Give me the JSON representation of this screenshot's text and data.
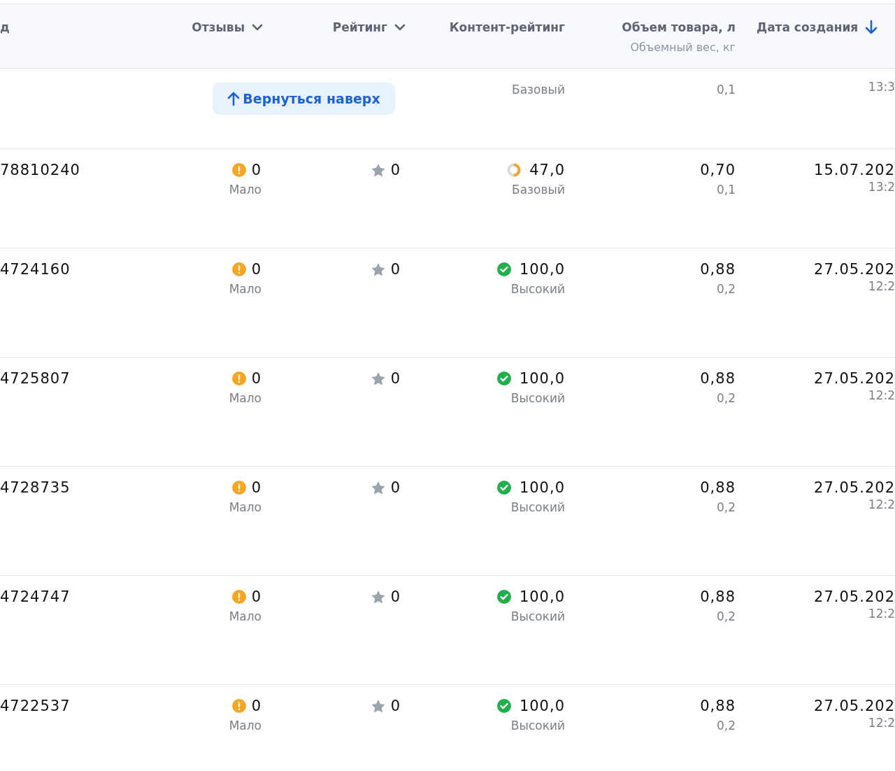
{
  "header": {
    "columns": [
      {
        "label": "д",
        "kind": "plain"
      },
      {
        "label": "Отзывы",
        "kind": "dropdown"
      },
      {
        "label": "Рейтинг",
        "kind": "dropdown"
      },
      {
        "label": "Контент-рейтинг",
        "kind": "plain"
      },
      {
        "label": "Объем товара, л",
        "sublabel": "Объемный вес, кг",
        "kind": "plain"
      },
      {
        "label": "Дата создания",
        "kind": "sorted"
      }
    ]
  },
  "back_to_top": {
    "label": "Вернуться наверх"
  },
  "rows": [
    {
      "content": {
        "label": "Базовый"
      },
      "weight": "0,1",
      "time": "13:3"
    },
    {
      "id": "78810240",
      "reviews": {
        "value": "0",
        "label": "Мало",
        "kind": "warning"
      },
      "rating": "0",
      "content": {
        "value": "47,0",
        "label": "Базовый",
        "kind": "partial"
      },
      "volume": "0,70",
      "weight": "0,1",
      "date": "15.07.202",
      "time": "13:2"
    },
    {
      "id": "4724160",
      "reviews": {
        "value": "0",
        "label": "Мало",
        "kind": "warning"
      },
      "rating": "0",
      "content": {
        "value": "100,0",
        "label": "Высокий",
        "kind": "complete"
      },
      "volume": "0,88",
      "weight": "0,2",
      "date": "27.05.202",
      "time": "12:2"
    },
    {
      "id": "4725807",
      "reviews": {
        "value": "0",
        "label": "Мало",
        "kind": "warning"
      },
      "rating": "0",
      "content": {
        "value": "100,0",
        "label": "Высокий",
        "kind": "complete"
      },
      "volume": "0,88",
      "weight": "0,2",
      "date": "27.05.202",
      "time": "12:2"
    },
    {
      "id": "4728735",
      "reviews": {
        "value": "0",
        "label": "Мало",
        "kind": "warning"
      },
      "rating": "0",
      "content": {
        "value": "100,0",
        "label": "Высокий",
        "kind": "complete"
      },
      "volume": "0,88",
      "weight": "0,2",
      "date": "27.05.202",
      "time": "12:2"
    },
    {
      "id": "4724747",
      "reviews": {
        "value": "0",
        "label": "Мало",
        "kind": "warning"
      },
      "rating": "0",
      "content": {
        "value": "100,0",
        "label": "Высокий",
        "kind": "complete"
      },
      "volume": "0,88",
      "weight": "0,2",
      "date": "27.05.202",
      "time": "12:2"
    },
    {
      "id": "4722537",
      "reviews": {
        "value": "0",
        "label": "Мало",
        "kind": "warning"
      },
      "rating": "0",
      "content": {
        "value": "100,0",
        "label": "Высокий",
        "kind": "complete"
      },
      "volume": "0,88",
      "weight": "0,2",
      "date": "27.05.202",
      "time": "12:2"
    }
  ]
}
